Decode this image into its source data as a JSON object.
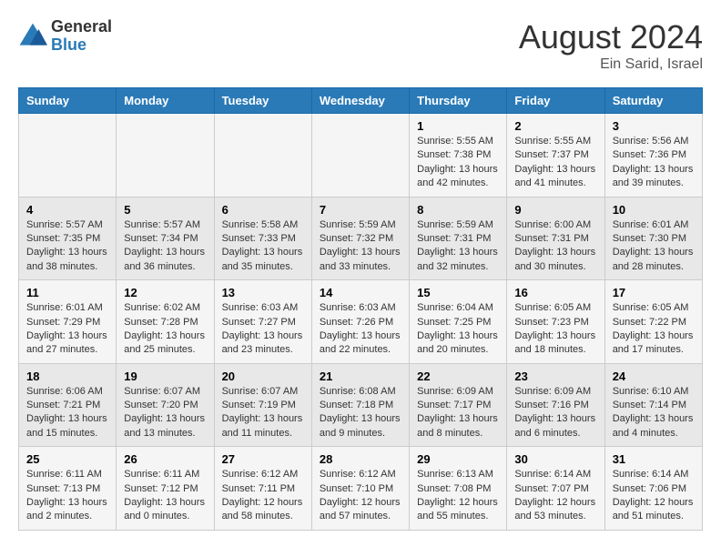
{
  "logo": {
    "general": "General",
    "blue": "Blue"
  },
  "title": "August 2024",
  "subtitle": "Ein Sarid, Israel",
  "headers": [
    "Sunday",
    "Monday",
    "Tuesday",
    "Wednesday",
    "Thursday",
    "Friday",
    "Saturday"
  ],
  "weeks": [
    [
      {
        "day": "",
        "info": ""
      },
      {
        "day": "",
        "info": ""
      },
      {
        "day": "",
        "info": ""
      },
      {
        "day": "",
        "info": ""
      },
      {
        "day": "1",
        "info": "Sunrise: 5:55 AM\nSunset: 7:38 PM\nDaylight: 13 hours\nand 42 minutes."
      },
      {
        "day": "2",
        "info": "Sunrise: 5:55 AM\nSunset: 7:37 PM\nDaylight: 13 hours\nand 41 minutes."
      },
      {
        "day": "3",
        "info": "Sunrise: 5:56 AM\nSunset: 7:36 PM\nDaylight: 13 hours\nand 39 minutes."
      }
    ],
    [
      {
        "day": "4",
        "info": "Sunrise: 5:57 AM\nSunset: 7:35 PM\nDaylight: 13 hours\nand 38 minutes."
      },
      {
        "day": "5",
        "info": "Sunrise: 5:57 AM\nSunset: 7:34 PM\nDaylight: 13 hours\nand 36 minutes."
      },
      {
        "day": "6",
        "info": "Sunrise: 5:58 AM\nSunset: 7:33 PM\nDaylight: 13 hours\nand 35 minutes."
      },
      {
        "day": "7",
        "info": "Sunrise: 5:59 AM\nSunset: 7:32 PM\nDaylight: 13 hours\nand 33 minutes."
      },
      {
        "day": "8",
        "info": "Sunrise: 5:59 AM\nSunset: 7:31 PM\nDaylight: 13 hours\nand 32 minutes."
      },
      {
        "day": "9",
        "info": "Sunrise: 6:00 AM\nSunset: 7:31 PM\nDaylight: 13 hours\nand 30 minutes."
      },
      {
        "day": "10",
        "info": "Sunrise: 6:01 AM\nSunset: 7:30 PM\nDaylight: 13 hours\nand 28 minutes."
      }
    ],
    [
      {
        "day": "11",
        "info": "Sunrise: 6:01 AM\nSunset: 7:29 PM\nDaylight: 13 hours\nand 27 minutes."
      },
      {
        "day": "12",
        "info": "Sunrise: 6:02 AM\nSunset: 7:28 PM\nDaylight: 13 hours\nand 25 minutes."
      },
      {
        "day": "13",
        "info": "Sunrise: 6:03 AM\nSunset: 7:27 PM\nDaylight: 13 hours\nand 23 minutes."
      },
      {
        "day": "14",
        "info": "Sunrise: 6:03 AM\nSunset: 7:26 PM\nDaylight: 13 hours\nand 22 minutes."
      },
      {
        "day": "15",
        "info": "Sunrise: 6:04 AM\nSunset: 7:25 PM\nDaylight: 13 hours\nand 20 minutes."
      },
      {
        "day": "16",
        "info": "Sunrise: 6:05 AM\nSunset: 7:23 PM\nDaylight: 13 hours\nand 18 minutes."
      },
      {
        "day": "17",
        "info": "Sunrise: 6:05 AM\nSunset: 7:22 PM\nDaylight: 13 hours\nand 17 minutes."
      }
    ],
    [
      {
        "day": "18",
        "info": "Sunrise: 6:06 AM\nSunset: 7:21 PM\nDaylight: 13 hours\nand 15 minutes."
      },
      {
        "day": "19",
        "info": "Sunrise: 6:07 AM\nSunset: 7:20 PM\nDaylight: 13 hours\nand 13 minutes."
      },
      {
        "day": "20",
        "info": "Sunrise: 6:07 AM\nSunset: 7:19 PM\nDaylight: 13 hours\nand 11 minutes."
      },
      {
        "day": "21",
        "info": "Sunrise: 6:08 AM\nSunset: 7:18 PM\nDaylight: 13 hours\nand 9 minutes."
      },
      {
        "day": "22",
        "info": "Sunrise: 6:09 AM\nSunset: 7:17 PM\nDaylight: 13 hours\nand 8 minutes."
      },
      {
        "day": "23",
        "info": "Sunrise: 6:09 AM\nSunset: 7:16 PM\nDaylight: 13 hours\nand 6 minutes."
      },
      {
        "day": "24",
        "info": "Sunrise: 6:10 AM\nSunset: 7:14 PM\nDaylight: 13 hours\nand 4 minutes."
      }
    ],
    [
      {
        "day": "25",
        "info": "Sunrise: 6:11 AM\nSunset: 7:13 PM\nDaylight: 13 hours\nand 2 minutes."
      },
      {
        "day": "26",
        "info": "Sunrise: 6:11 AM\nSunset: 7:12 PM\nDaylight: 13 hours\nand 0 minutes."
      },
      {
        "day": "27",
        "info": "Sunrise: 6:12 AM\nSunset: 7:11 PM\nDaylight: 12 hours\nand 58 minutes."
      },
      {
        "day": "28",
        "info": "Sunrise: 6:12 AM\nSunset: 7:10 PM\nDaylight: 12 hours\nand 57 minutes."
      },
      {
        "day": "29",
        "info": "Sunrise: 6:13 AM\nSunset: 7:08 PM\nDaylight: 12 hours\nand 55 minutes."
      },
      {
        "day": "30",
        "info": "Sunrise: 6:14 AM\nSunset: 7:07 PM\nDaylight: 12 hours\nand 53 minutes."
      },
      {
        "day": "31",
        "info": "Sunrise: 6:14 AM\nSunset: 7:06 PM\nDaylight: 12 hours\nand 51 minutes."
      }
    ]
  ]
}
